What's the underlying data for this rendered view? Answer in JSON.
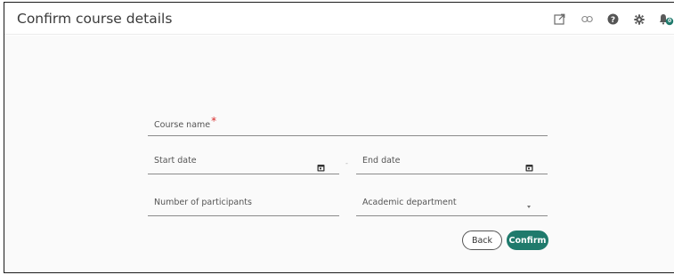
{
  "header": {
    "title": "Confirm course details",
    "notification_badge": "0",
    "icons": [
      "external-link-icon",
      "link-icon",
      "help-icon",
      "settings-icon",
      "notifications-icon"
    ]
  },
  "form": {
    "course_name": {
      "label": "Course name",
      "required_mark": "*",
      "value": ""
    },
    "start_date": {
      "label": "Start date",
      "value": ""
    },
    "date_separator": "-",
    "end_date": {
      "label": "End date",
      "value": ""
    },
    "participants": {
      "label": "Number of participants",
      "value": ""
    },
    "department": {
      "label": "Academic department",
      "value": ""
    }
  },
  "actions": {
    "back_label": "Back",
    "confirm_label": "Confirm"
  },
  "colors": {
    "accent": "#1f7a6c",
    "required": "#d82d2d",
    "frame_border": "#1a1a1a"
  }
}
